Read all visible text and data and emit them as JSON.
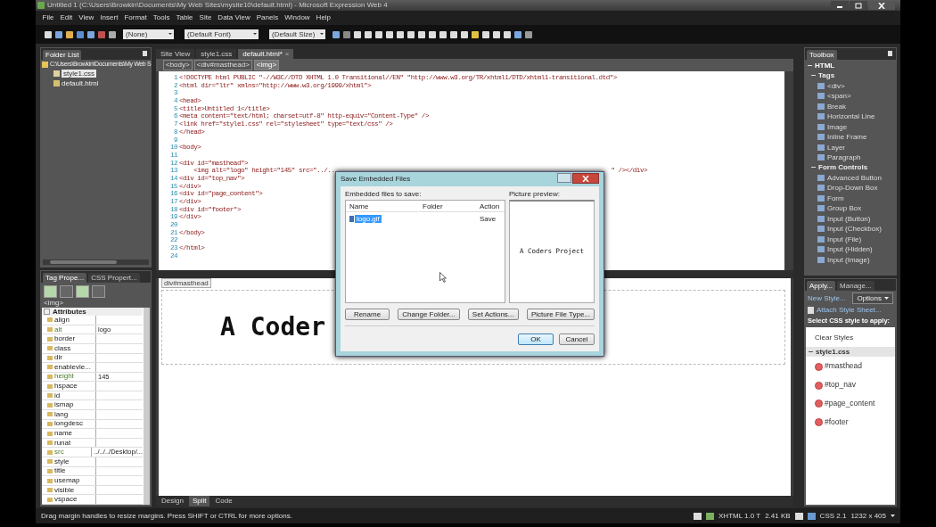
{
  "window": {
    "title": "Untitled 1 (C:\\Users\\Browkin\\Documents\\My Web Sites\\mysite10\\default.html) - Microsoft Expression Web 4"
  },
  "menu": [
    "File",
    "Edit",
    "View",
    "Insert",
    "Format",
    "Tools",
    "Table",
    "Site",
    "Data View",
    "Panels",
    "Window",
    "Help"
  ],
  "toolbar": {
    "style": "(None)",
    "font": "(Default Font)",
    "size": "(Default Size)"
  },
  "folder_list": {
    "title": "Folder List",
    "path": "C:\\Users\\Browkin\\Documents\\My Web S",
    "items": [
      {
        "name": "style1.css",
        "kind": "css",
        "selected": true
      },
      {
        "name": "default.html",
        "kind": "html",
        "selected": false
      }
    ]
  },
  "tag_panel": {
    "tabs": [
      {
        "label": "Tag Prope...",
        "selected": true
      },
      {
        "label": "CSS Propert...",
        "selected": false
      }
    ],
    "tag": "<img>",
    "header": "Attributes",
    "attributes": [
      {
        "name": "align",
        "set": false
      },
      {
        "name": "alt",
        "value": "logo",
        "set": true
      },
      {
        "name": "border",
        "set": false
      },
      {
        "name": "class",
        "set": false
      },
      {
        "name": "dir",
        "set": false
      },
      {
        "name": "enablevie...",
        "set": false
      },
      {
        "name": "height",
        "value": "145",
        "set": true
      },
      {
        "name": "hspace",
        "set": false
      },
      {
        "name": "id",
        "set": false
      },
      {
        "name": "ismap",
        "set": false
      },
      {
        "name": "lang",
        "set": false
      },
      {
        "name": "longdesc",
        "set": false
      },
      {
        "name": "name",
        "set": false
      },
      {
        "name": "runat",
        "set": false
      },
      {
        "name": "src",
        "value": "../../../Desktop/...",
        "set": true
      },
      {
        "name": "style",
        "set": false
      },
      {
        "name": "title",
        "set": false
      },
      {
        "name": "usemap",
        "set": false
      },
      {
        "name": "visible",
        "set": false
      },
      {
        "name": "vspace",
        "set": false
      }
    ]
  },
  "editor": {
    "tabs": [
      {
        "label": "Site View",
        "selected": false
      },
      {
        "label": "style1.css",
        "selected": false
      },
      {
        "label": "default.html*",
        "selected": true,
        "close": "×"
      }
    ],
    "breadcrumb": [
      {
        "label": "<body>",
        "selected": false
      },
      {
        "label": "<div#masthead>",
        "selected": false
      },
      {
        "label": "<img>",
        "selected": true
      }
    ],
    "lines": [
      {
        "number": "1",
        "text": "<!DOCTYPE html PUBLIC \"-//W3C//DTD XHTML 1.0 Transitional//EN\" \"http://www.w3.org/TR/xhtml1/DTD/xhtml1-transitional.dtd\">"
      },
      {
        "number": "2",
        "text": "<html dir=\"ltr\" xmlns=\"http://www.w3.org/1999/xhtml\">"
      },
      {
        "number": "3"
      },
      {
        "number": "4",
        "text": "<head>"
      },
      {
        "number": "5",
        "text": "<title>Untitled 1</title>"
      },
      {
        "number": "6",
        "text": "<meta content=\"text/html; charset=utf-8\" http-equiv=\"Content-Type\" />"
      },
      {
        "number": "7",
        "text": "<link href=\"style1.css\" rel=\"stylesheet\" type=\"text/css\" />"
      },
      {
        "number": "8",
        "text": "</head>"
      },
      {
        "number": "9"
      },
      {
        "number": "10",
        "text": "<body>"
      },
      {
        "number": "11"
      },
      {
        "number": "12",
        "text": "<div id=\"masthead\">"
      },
      {
        "number": "13",
        "text": "    <img alt=\"logo\" height=\"145\" src=\"../..",
        "tail": "\" /></div>"
      },
      {
        "number": "14",
        "text": "<div id=\"top_nav\">"
      },
      {
        "number": "15",
        "text": "</div>"
      },
      {
        "number": "16",
        "text": "<div id=\"page_content\">"
      },
      {
        "number": "17",
        "text": "</div>"
      },
      {
        "number": "18",
        "text": "<div id=\"footer\">"
      },
      {
        "number": "19",
        "text": "</div>"
      },
      {
        "number": "20"
      },
      {
        "number": "21",
        "text": "</body>"
      },
      {
        "number": "22"
      },
      {
        "number": "23",
        "text": "</html>"
      },
      {
        "number": "24"
      }
    ],
    "design_label": "div#masthead",
    "design_text": "A Coder",
    "view_tabs": [
      {
        "label": "Design",
        "selected": false
      },
      {
        "label": "Split",
        "selected": true
      },
      {
        "label": "Code",
        "selected": false
      }
    ]
  },
  "toolbox": {
    "title": "Toolbox",
    "groups": [
      {
        "label": "HTML",
        "expanded": true,
        "children": [
          {
            "label": "Tags",
            "expanded": true,
            "children": [
              {
                "label": "<div>"
              },
              {
                "label": "<span>"
              },
              {
                "label": "Break"
              },
              {
                "label": "Horizontal Line"
              },
              {
                "label": "Image"
              },
              {
                "label": "Inline Frame"
              },
              {
                "label": "Layer"
              },
              {
                "label": "Paragraph"
              }
            ]
          },
          {
            "label": "Form Controls",
            "expanded": true,
            "children": [
              {
                "label": "Advanced Button"
              },
              {
                "label": "Drop-Down Box"
              },
              {
                "label": "Form"
              },
              {
                "label": "Group Box"
              },
              {
                "label": "Input (Button)"
              },
              {
                "label": "Input (Checkbox)"
              },
              {
                "label": "Input (File)"
              },
              {
                "label": "Input (Hidden)"
              },
              {
                "label": "Input (Image)"
              }
            ]
          }
        ]
      }
    ]
  },
  "apply_panel": {
    "tabs": [
      {
        "label": "Apply...",
        "selected": true
      },
      {
        "label": "Manage...",
        "selected": false
      }
    ],
    "new_style": "New Style...",
    "options": "Options",
    "attach": "Attach Style Sheet...",
    "prompt": "Select CSS style to apply:",
    "clear": "Clear Styles",
    "sheet": {
      "name": "style1.css",
      "expanded": true,
      "styles": [
        "#masthead",
        "#top_nav",
        "#page_content",
        "#footer"
      ]
    }
  },
  "dialog": {
    "title": "Save Embedded Files",
    "list_label": "Embedded files to save:",
    "columns": [
      "Name",
      "Folder",
      "Action"
    ],
    "files": [
      {
        "name": "logo.gif",
        "action": "Save",
        "selected": true
      }
    ],
    "preview_label": "Picture preview:",
    "preview_text": "A Coders Project",
    "buttons": [
      "Rename",
      "Change Folder...",
      "Set Actions...",
      "Picture File Type..."
    ],
    "ok": "OK",
    "cancel": "Cancel"
  },
  "status_bar": {
    "message": "Drag margin handles to resize margins. Press SHIFT or CTRL for more options.",
    "doctype": "XHTML 1.0 T",
    "size": "2.41 KB",
    "css": "CSS 2.1",
    "dimensions": "1232 x 405"
  }
}
